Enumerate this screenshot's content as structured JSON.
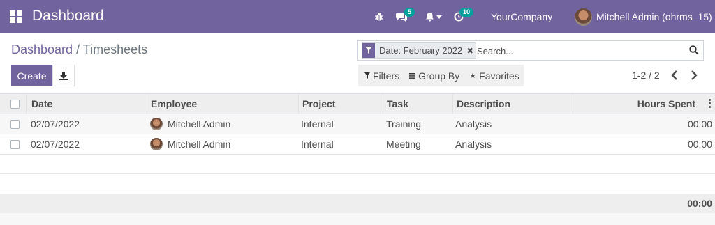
{
  "navbar": {
    "app_title": "Dashboard",
    "messages_count": "5",
    "activities_count": "10",
    "company": "YourCompany",
    "user": "Mitchell Admin (ohrms_15)"
  },
  "breadcrumb": {
    "parent": "Dashboard",
    "separator": "/",
    "current": "Timesheets"
  },
  "search": {
    "facet_label": "Date: February 2022",
    "placeholder": "Search..."
  },
  "buttons": {
    "create": "Create"
  },
  "filters": {
    "filters_label": "Filters",
    "group_by_label": "Group By",
    "favorites_label": "Favorites"
  },
  "pager": {
    "range": "1-2 / 2"
  },
  "table": {
    "columns": {
      "date": "Date",
      "employee": "Employee",
      "project": "Project",
      "task": "Task",
      "description": "Description",
      "hours": "Hours Spent"
    },
    "rows": [
      {
        "date": "02/07/2022",
        "employee": "Mitchell Admin",
        "project": "Internal",
        "task": "Training",
        "description": "Analysis",
        "hours": "00:00"
      },
      {
        "date": "02/07/2022",
        "employee": "Mitchell Admin",
        "project": "Internal",
        "task": "Meeting",
        "description": "Analysis",
        "hours": "00:00"
      }
    ],
    "total_hours": "00:00"
  },
  "colors": {
    "brand": "#71639e",
    "badge": "#00a09d"
  },
  "icons": [
    "apps-icon",
    "bug-icon",
    "chat-icon",
    "bell-icon",
    "clock-icon",
    "filter-icon",
    "close-icon",
    "search-icon",
    "download-icon",
    "group-by-icon",
    "star-icon",
    "chevron-left-icon",
    "chevron-right-icon",
    "kebab-icon"
  ]
}
